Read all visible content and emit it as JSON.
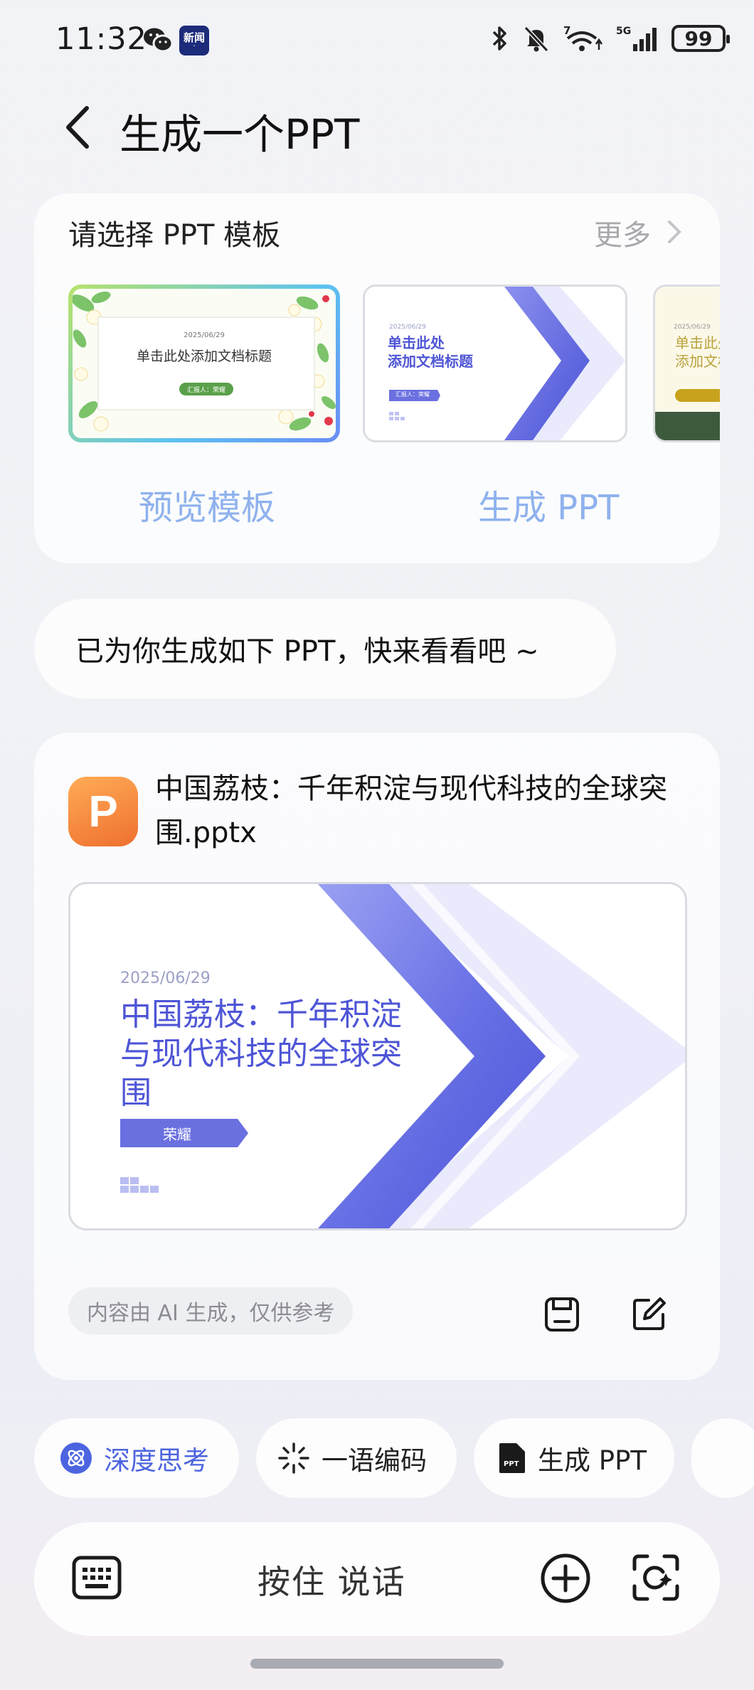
{
  "status_bar": {
    "time": "11:32",
    "news_badge": "新闻",
    "battery": "99",
    "network": "5G"
  },
  "header": {
    "title": "生成一个PPT"
  },
  "template_section": {
    "title": "请选择 PPT 模板",
    "more_label": "更多",
    "templates": [
      {
        "date": "2025/06/29",
        "title": "单击此处添加文档标题",
        "reporter": "汇报人：荣耀"
      },
      {
        "date": "2025/06/29",
        "title_line1": "单击此处",
        "title_line2": "添加文档标题",
        "reporter": "汇报人：荣耀"
      },
      {
        "date": "2025/06/29",
        "title_line1": "单击此处",
        "title_line2": "添加文档"
      }
    ],
    "preview_label": "预览模板",
    "generate_label": "生成 PPT"
  },
  "reply_bubble": {
    "text": "已为你生成如下 PPT，快来看看吧 ~"
  },
  "result_card": {
    "file_icon_letter": "P",
    "file_name": "中国荔枝：千年积淀与现代科技的全球突围.pptx",
    "slide": {
      "date": "2025/06/29",
      "title": "中国荔枝：千年积淀与现代科技的全球突围",
      "presenter": "荣耀"
    },
    "disclaimer": "内容由 AI 生成，仅供参考"
  },
  "chips": [
    {
      "label": "深度思考"
    },
    {
      "label": "一语编码"
    },
    {
      "label": "生成 PPT"
    }
  ],
  "input_bar": {
    "hold_to_talk": "按住 说话"
  },
  "colors": {
    "accent_blue": "#4c64df",
    "ppt_orange": "#ef7a34",
    "action_blue": "#8fb2ee",
    "slide_purple": "#5860dd"
  }
}
